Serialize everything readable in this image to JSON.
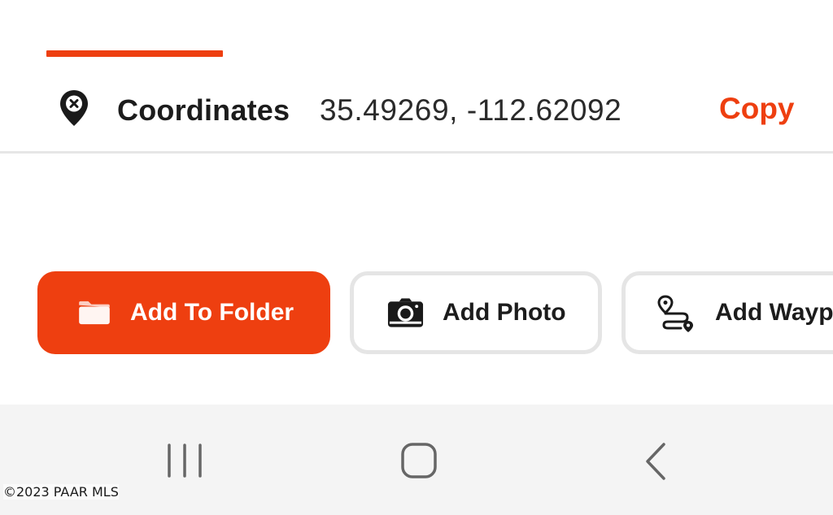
{
  "colors": {
    "accent": "#ee3f10"
  },
  "coordinates": {
    "icon": "map-pin-x-icon",
    "label": "Coordinates",
    "value": "35.49269, -112.62092",
    "copy_label": "Copy"
  },
  "actions": [
    {
      "label": "Add To Folder",
      "icon": "folder-icon",
      "style": "primary"
    },
    {
      "label": "Add Photo",
      "icon": "camera-icon",
      "style": "outline"
    },
    {
      "label": "Add Waypo",
      "icon": "route-waypoint-icon",
      "style": "outline"
    }
  ],
  "navbar": {
    "items": [
      {
        "name": "recents",
        "icon": "recents-icon"
      },
      {
        "name": "home",
        "icon": "home-icon"
      },
      {
        "name": "back",
        "icon": "back-icon"
      }
    ]
  },
  "watermark": "©2023 PAAR MLS"
}
